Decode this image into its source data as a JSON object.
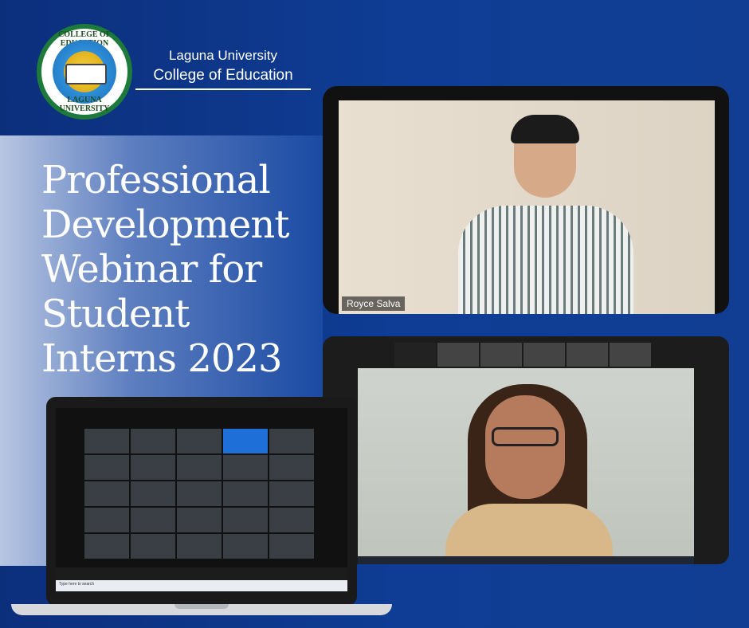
{
  "org": {
    "line1": "Laguna University",
    "line2": "College of Education"
  },
  "seal": {
    "top_text": "COLLEGE OF EDUCATION",
    "bottom_text": "LAGUNA UNIVERSITY"
  },
  "headline": {
    "l1": "Professional",
    "l2": "Development",
    "l3": "Webinar for",
    "l4": "Student",
    "l5": "Interns 2023"
  },
  "video1": {
    "name": "Royce Salva"
  },
  "laptop": {
    "search": "Type here to search"
  },
  "colors": {
    "background": "#0e3a8f",
    "band": "#5e7fc0",
    "text": "#ffffff"
  }
}
